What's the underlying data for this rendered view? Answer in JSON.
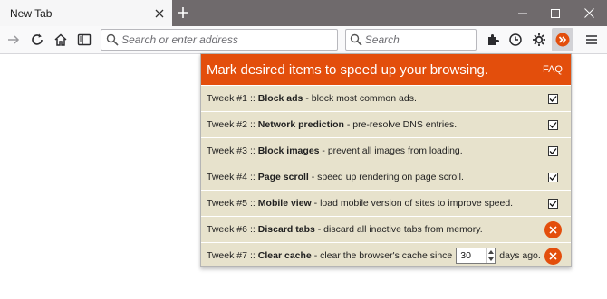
{
  "tabstrip": {
    "tab_title": "New Tab",
    "tab_close_icon": "close-icon",
    "new_tab_icon": "plus-icon",
    "window_controls": [
      "minimize-icon",
      "maximize-icon",
      "close-icon"
    ]
  },
  "toolbar": {
    "forward_icon": "arrow-right-icon",
    "reload_icon": "reload-icon",
    "home_icon": "home-icon",
    "sidebar_icon": "sidebar-icon",
    "url_placeholder": "Search or enter address",
    "search_placeholder": "Search",
    "right_icons": [
      "extensions-icon",
      "history-icon",
      "settings-icon",
      "speed-tweaks-extension-icon",
      "menu-icon"
    ]
  },
  "popup": {
    "title": "Mark desired items to speed up your browsing.",
    "faq_label": "FAQ",
    "accent_color": "#e34e0c",
    "background_color": "#e7e2cc",
    "tweaks": [
      {
        "prefix": "Tweek #1",
        "sep": "::",
        "name": "Block ads",
        "desc": "- block most common ads.",
        "state": "checked"
      },
      {
        "prefix": "Tweek #2",
        "sep": "::",
        "name": "Network prediction",
        "desc": "- pre-resolve DNS entries.",
        "state": "checked"
      },
      {
        "prefix": "Tweek #3",
        "sep": "::",
        "name": "Block images",
        "desc": "- prevent all images from loading.",
        "state": "checked"
      },
      {
        "prefix": "Tweek #4",
        "sep": "::",
        "name": "Page scroll",
        "desc": "- speed up rendering on page scroll.",
        "state": "checked"
      },
      {
        "prefix": "Tweek #5",
        "sep": "::",
        "name": "Mobile view",
        "desc": "- load mobile version of sites to improve speed.",
        "state": "checked"
      },
      {
        "prefix": "Tweek #6",
        "sep": "::",
        "name": "Discard tabs",
        "desc": "- discard all inactive tabs from memory.",
        "state": "disabled"
      },
      {
        "prefix": "Tweek #7",
        "sep": "::",
        "name": "Clear cache",
        "desc": "- clear the browser's cache since",
        "spin_value": "30",
        "suffix": "days ago.",
        "state": "disabled"
      }
    ]
  }
}
